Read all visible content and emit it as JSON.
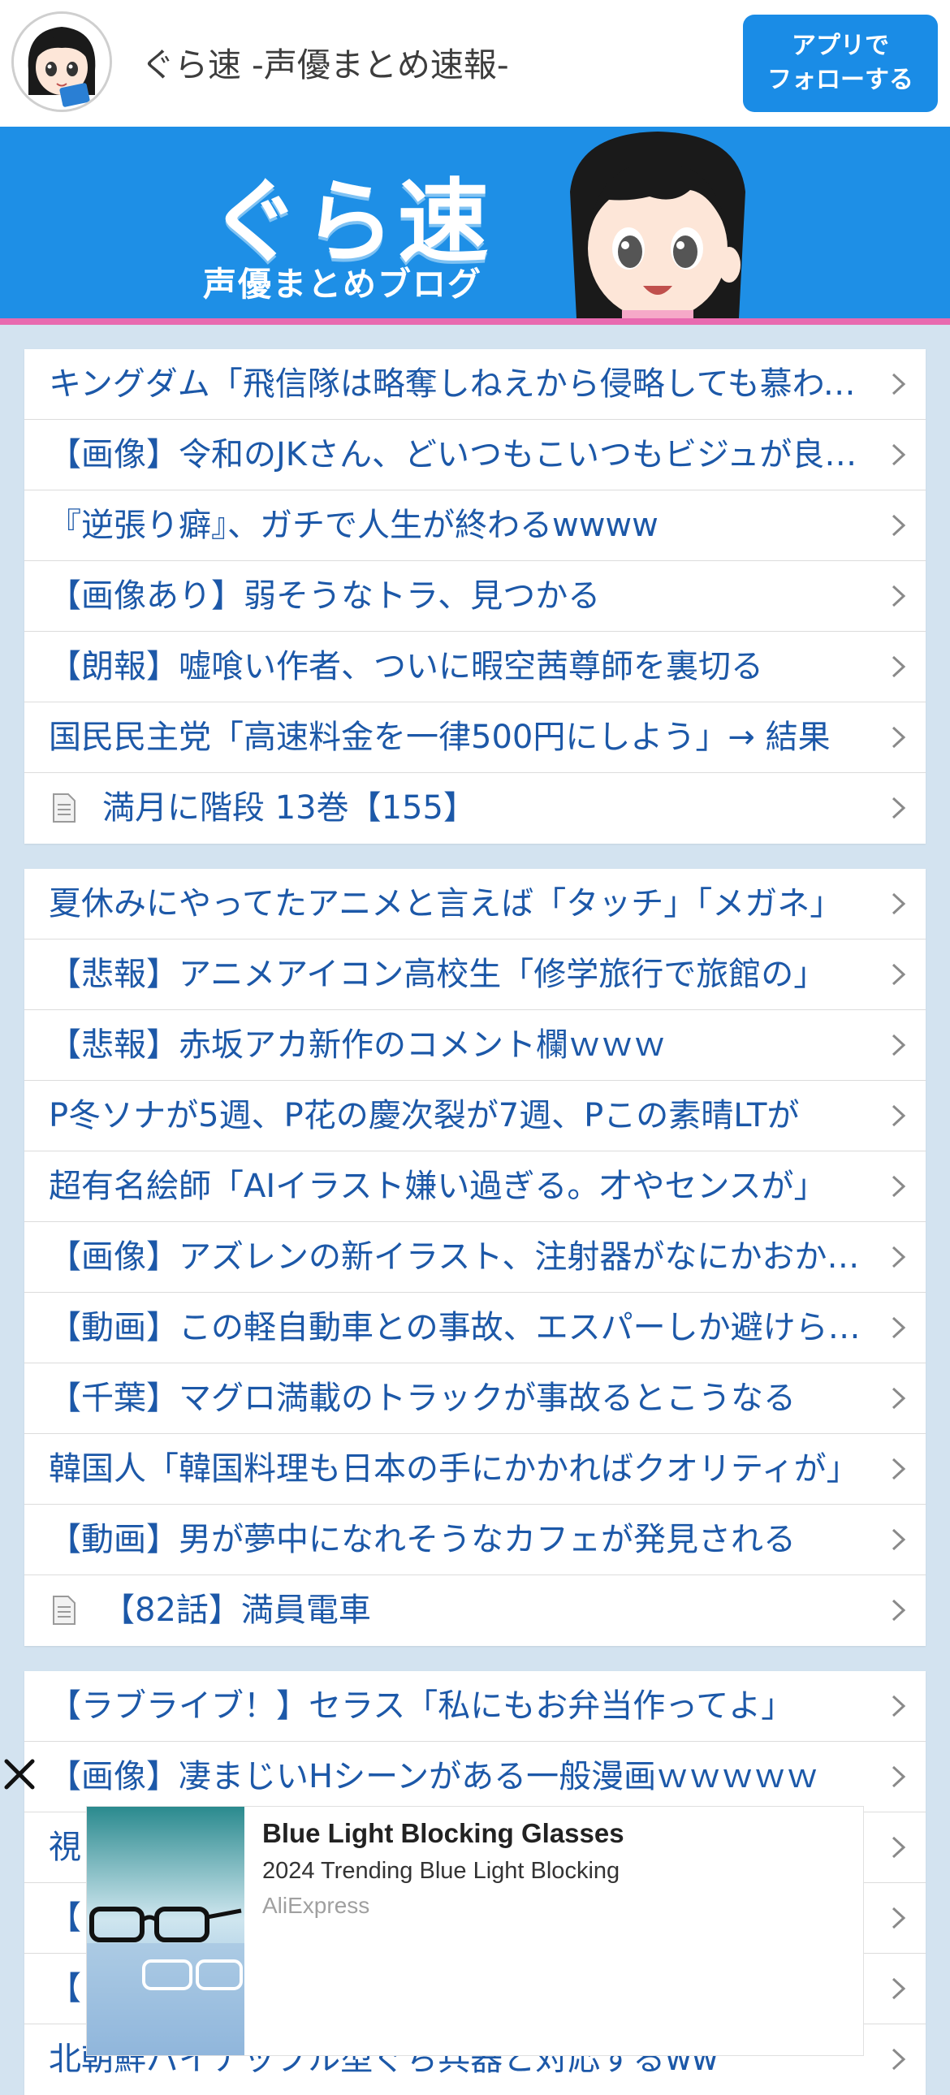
{
  "header": {
    "site_title": "ぐら速 -声優まとめ速報-",
    "follow_button": "アプリで\nフォローする",
    "accent": "#1a8ce6"
  },
  "banner": {
    "logo_main": "ぐら速",
    "logo_sub": "声優まとめブログ",
    "background": "#1e8fe6",
    "stripe": "#e86ab0"
  },
  "lists": [
    {
      "items": [
        {
          "title": "キングダム「飛信隊は略奪しねえから侵略しても慕われるぜ」",
          "icon": "chevron-right-icon"
        },
        {
          "title": "【画像】令和のJKさん、どいつもこいつもビジュが良すぎる",
          "icon": "chevron-right-icon"
        },
        {
          "title": "『逆張り癖』、ガチで人生が終わるwwww",
          "icon": "chevron-right-icon"
        },
        {
          "title": "【画像あり】弱そうなトラ、見つかる",
          "icon": "chevron-right-icon"
        },
        {
          "title": "【朗報】嘘喰い作者、ついに暇空茜尊師を裏切る",
          "icon": "chevron-right-icon"
        },
        {
          "title": "国民民主党「高速料金を一律500円にしよう」→ 結果",
          "icon": "chevron-right-icon"
        },
        {
          "title": "満月に階段 13巻【155】",
          "icon": "document-icon",
          "doc": true
        }
      ]
    },
    {
      "items": [
        {
          "title": "夏休みにやってたアニメと言えば「タッチ」「メガネ」",
          "icon": "chevron-right-icon"
        },
        {
          "title": "【悲報】アニメアイコン高校生「修学旅行で旅館の」",
          "icon": "chevron-right-icon"
        },
        {
          "title": "【悲報】赤坂アカ新作のコメント欄ｗｗｗ",
          "icon": "chevron-right-icon"
        },
        {
          "title": "P冬ソナが5週、P花の慶次裂が7週、Pこの素晴LTが",
          "icon": "chevron-right-icon"
        },
        {
          "title": "超有名絵師「AIイラスト嫌い過ぎる。才やセンスが」",
          "icon": "chevron-right-icon"
        },
        {
          "title": "【画像】アズレンの新イラスト、注射器がなにかおかしい",
          "icon": "chevron-right-icon"
        },
        {
          "title": "【動画】この軽自動車との事故、エスパーしか避けられない",
          "icon": "chevron-right-icon"
        },
        {
          "title": "【千葉】マグロ満載のトラックが事故るとこうなる",
          "icon": "chevron-right-icon"
        },
        {
          "title": "韓国人「韓国料理も日本の手にかかればクオリティが」",
          "icon": "chevron-right-icon"
        },
        {
          "title": "【動画】男が夢中になれそうなカフェが発見される",
          "icon": "chevron-right-icon"
        },
        {
          "title": "【82話】満員電車",
          "icon": "document-icon",
          "doc": true
        }
      ]
    },
    {
      "items": [
        {
          "title": "【ラブライブ！】セラス「私にもお弁当作ってよ」",
          "icon": "chevron-right-icon"
        },
        {
          "title": "【画像】凄まじいHシーンがある一般漫画ｗｗｗｗｗ",
          "icon": "chevron-right-icon"
        },
        {
          "title": "視",
          "icon": "chevron-right-icon"
        },
        {
          "title": "【",
          "icon": "chevron-right-icon"
        },
        {
          "title": "【",
          "icon": "chevron-right-icon"
        },
        {
          "title": "北朝鮮パイナップル型ぐち兵器と対応するww",
          "icon": "chevron-right-icon"
        }
      ]
    }
  ],
  "ad": {
    "title": "Blue Light Blocking Glasses",
    "description": "2024 Trending Blue Light Blocking",
    "source": "AliExpress",
    "close_icon": "close-icon"
  }
}
